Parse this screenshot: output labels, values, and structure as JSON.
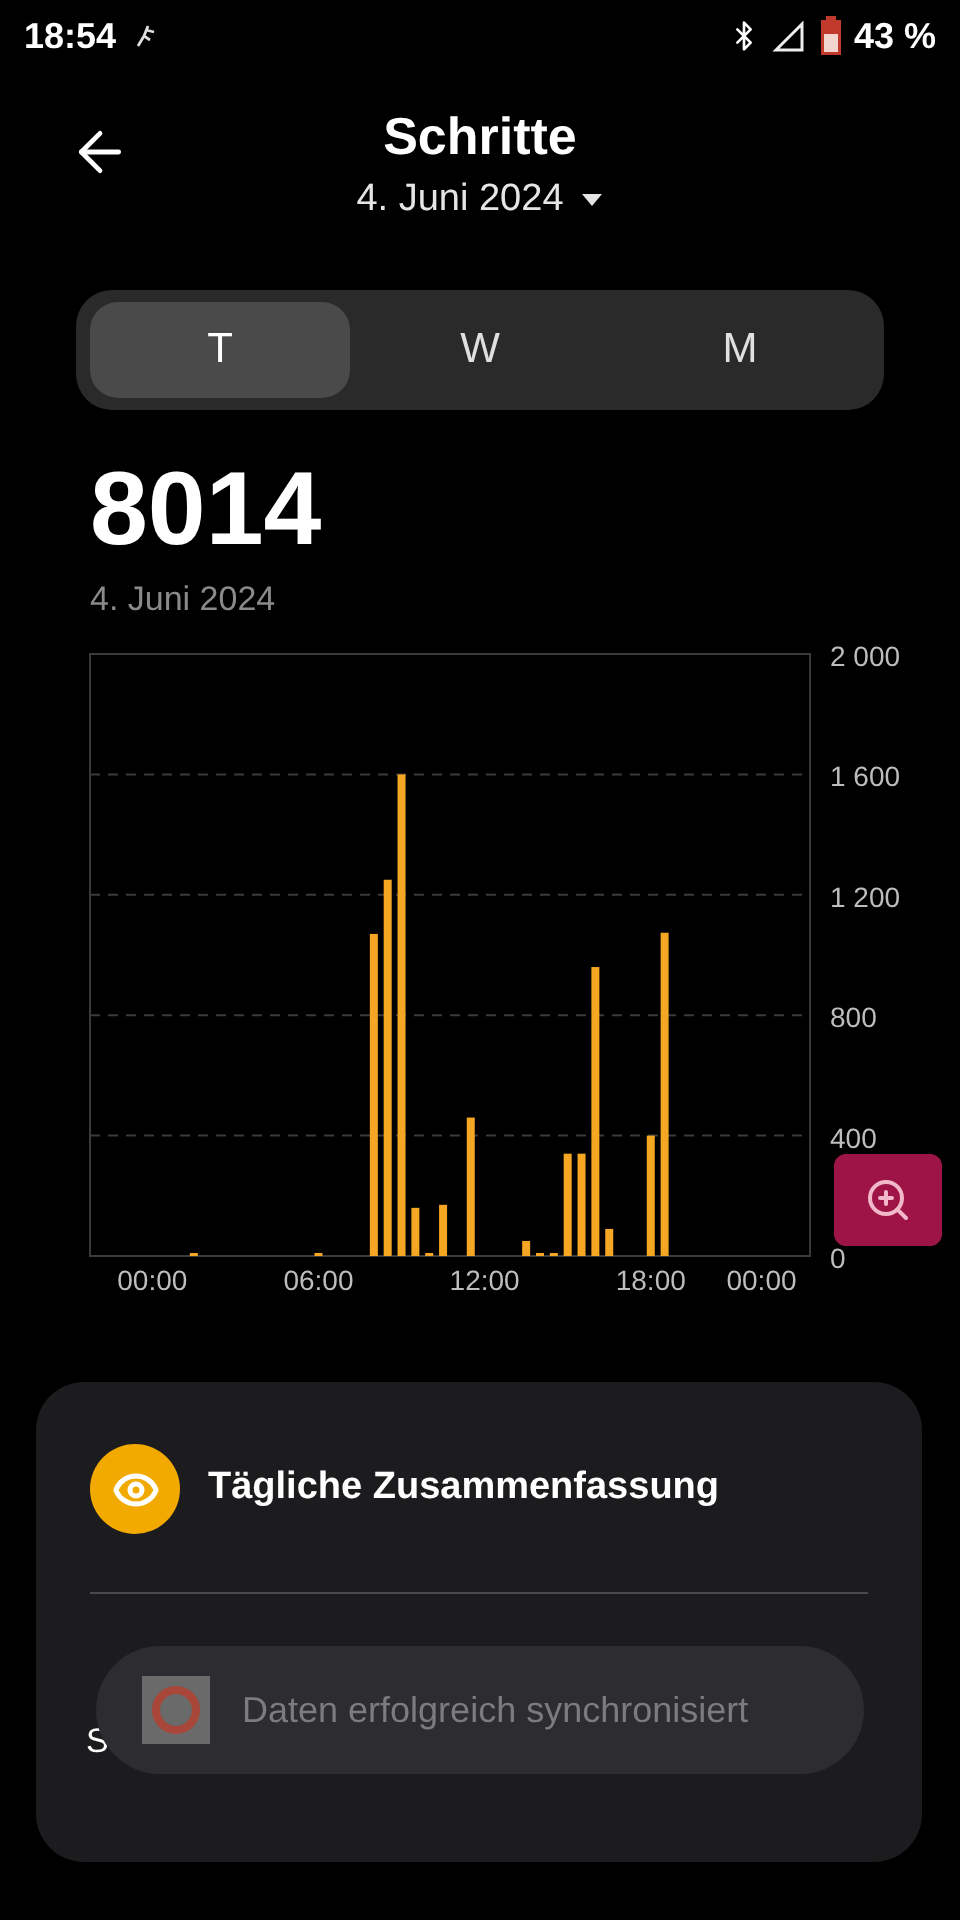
{
  "status_bar": {
    "time": "18:54",
    "battery": "43 %"
  },
  "header": {
    "title": "Schritte",
    "date": "4. Juni 2024"
  },
  "tabs": [
    {
      "label": "T",
      "selected": true
    },
    {
      "label": "W",
      "selected": false
    },
    {
      "label": "M",
      "selected": false
    }
  ],
  "total": {
    "value": "8014",
    "date": "4. Juni 2024"
  },
  "chart_data": {
    "type": "bar",
    "categories": [
      null,
      null,
      null,
      null,
      "00:00",
      null,
      null,
      null,
      null,
      null,
      null,
      null,
      null,
      null,
      null,
      null,
      "06:00",
      null,
      null,
      null,
      null,
      null,
      null,
      null,
      null,
      null,
      null,
      null,
      "12:00",
      null,
      null,
      null,
      null,
      null,
      null,
      null,
      null,
      null,
      null,
      null,
      "18:00",
      null,
      null,
      null,
      null,
      null,
      null,
      null,
      "00:00",
      null,
      null,
      null
    ],
    "series": [
      {
        "color": "#f5a623",
        "values": [
          null,
          null,
          null,
          null,
          null,
          null,
          null,
          10,
          null,
          null,
          null,
          null,
          null,
          null,
          null,
          null,
          10,
          null,
          null,
          null,
          1070,
          1250,
          1600,
          160,
          10,
          170,
          null,
          460,
          null,
          null,
          null,
          50,
          10,
          10,
          340,
          340,
          960,
          90,
          null,
          null,
          400,
          1074,
          null,
          null,
          null,
          null,
          null,
          null,
          null,
          null,
          null,
          null
        ]
      }
    ],
    "ylim": [
      0,
      2000
    ],
    "grid": true,
    "yticks": [
      {
        "value": 0,
        "label": "0"
      },
      {
        "value": 400,
        "label": "400"
      },
      {
        "value": 800,
        "label": "800"
      },
      {
        "value": 1200,
        "label": "1 200"
      },
      {
        "value": 1600,
        "label": "1 600"
      },
      {
        "value": 2000,
        "label": "2 000"
      }
    ]
  },
  "summary_card": {
    "title": "Tägliche Zusammenfassung",
    "second_row_partial": "S"
  },
  "toast": {
    "message": "Daten erfolgreich synchronisiert"
  }
}
